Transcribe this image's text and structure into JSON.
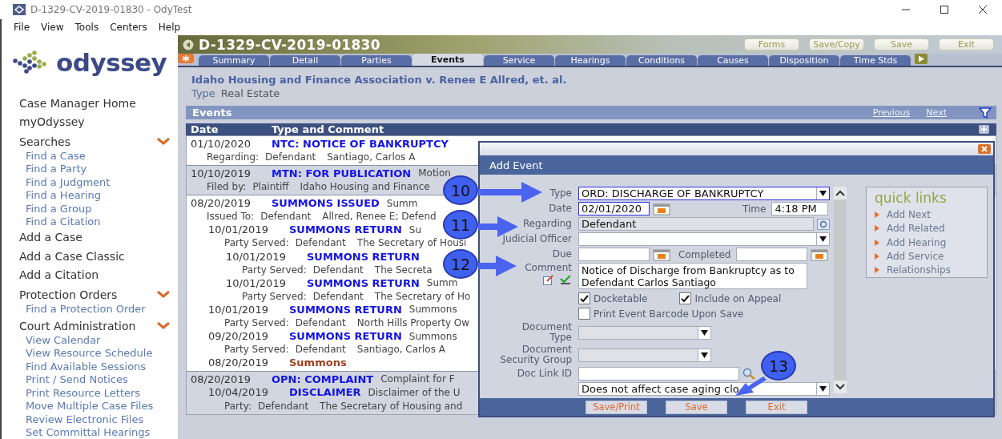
{
  "window": {
    "title": "D-1329-CV-2019-01830 - OdyTest"
  },
  "menu": [
    "File",
    "View",
    "Tools",
    "Centers",
    "Help"
  ],
  "sidebar": {
    "logo": "odyssey",
    "items": [
      {
        "kind": "link",
        "label": "Case Manager Home"
      },
      {
        "kind": "link",
        "label": "myOdyssey"
      },
      {
        "kind": "section",
        "label": "Searches",
        "expanded": true,
        "children": [
          "Find a Case",
          "Find a Party",
          "Find a Judgment",
          "Find a Hearing",
          "Find a Group",
          "Find a Citation"
        ]
      },
      {
        "kind": "link",
        "label": "Add a Case"
      },
      {
        "kind": "link",
        "label": "Add a Case Classic"
      },
      {
        "kind": "link",
        "label": "Add a Citation"
      },
      {
        "kind": "section",
        "label": "Protection Orders",
        "expanded": true,
        "children": [
          "Find a Protection Order"
        ]
      },
      {
        "kind": "section",
        "label": "Court Administration",
        "expanded": true,
        "children": [
          "View Calendar",
          "View Resource Schedule",
          "Find Available Sessions",
          "Print / Send Notices",
          "Print Resource Letters",
          "Move Multiple Case Files",
          "Review Electronic Files",
          "Set Committal Hearings"
        ]
      }
    ]
  },
  "case": {
    "number": "D-1329-CV-2019-01830",
    "buttons": [
      "Forms",
      "Save/Copy",
      "Save",
      "Exit"
    ],
    "tabs": [
      {
        "label": "Summary",
        "selected": false
      },
      {
        "label": "Detail",
        "selected": false
      },
      {
        "label": "Parties",
        "selected": false
      },
      {
        "label": "Events",
        "selected": true
      },
      {
        "label": "Service",
        "selected": false
      },
      {
        "label": "Hearings",
        "selected": false
      },
      {
        "label": "Conditions",
        "selected": false
      },
      {
        "label": "Causes",
        "selected": false
      },
      {
        "label": "Disposition",
        "selected": false
      },
      {
        "label": "Time Stds",
        "selected": false
      }
    ],
    "title": "Idaho Housing and Finance Association v. Renee E Allred, et. al.",
    "type_label": "Type",
    "type_value": "Real Estate"
  },
  "events": {
    "title": "Events",
    "nav": [
      "Previous",
      "Next"
    ],
    "columns": [
      "Date",
      "Type and Comment"
    ],
    "groups": [
      {
        "shaded": false,
        "events": [
          {
            "kind": "event",
            "date": "01/10/2020",
            "type": "NTC: NOTICE OF BANKRUPTCY",
            "detail": [
              "Regarding:",
              "Defendant",
              "Santiago, Carlos A"
            ]
          }
        ]
      },
      {
        "shaded": true,
        "events": [
          {
            "kind": "event",
            "date": "10/10/2019",
            "type": "MTN: FOR PUBLICATION",
            "comment": "Motion",
            "detail": [
              "Filed by:",
              "Plaintiff",
              "Idaho Housing and Finance"
            ]
          }
        ]
      },
      {
        "shaded": false,
        "events": [
          {
            "kind": "event",
            "date": "08/20/2019",
            "type": "SUMMONS ISSUED",
            "comment": "Summ",
            "detail": [
              "Issued To:",
              "Defendant",
              "Allred, Renee E; Defend"
            ],
            "children": [
              {
                "kind": "event",
                "date": "10/01/2019",
                "type": "SUMMONS RETURN",
                "comment": "Su",
                "detail": [
                  "Party Served:",
                  "Defendant",
                  "The Secretary of Housi"
                ],
                "children": [
                  {
                    "kind": "event",
                    "date": "10/01/2019",
                    "type": "SUMMONS RETURN",
                    "detail": [
                      "Party Served:",
                      "Defendant",
                      "The Secreta"
                    ]
                  },
                  {
                    "kind": "event",
                    "date": "10/01/2019",
                    "type": "SUMMONS RETURN",
                    "comment": "Summ",
                    "detail": [
                      "Party Served:",
                      "Defendant",
                      "The Secretary of Ho"
                    ]
                  }
                ]
              },
              {
                "kind": "event",
                "date": "10/01/2019",
                "type": "SUMMONS RETURN",
                "comment": "Summons",
                "detail": [
                  "Party Served:",
                  "Defendant",
                  "North Hills Property Ow"
                ]
              },
              {
                "kind": "event",
                "date": "09/20/2019",
                "type": "SUMMONS RETURN",
                "comment": "Summons",
                "detail": [
                  "Party Served:",
                  "Defendant",
                  "Santiago, Carlos A"
                ]
              },
              {
                "kind": "document",
                "date": "08/20/2019",
                "type": "Summons"
              }
            ]
          }
        ]
      },
      {
        "shaded": true,
        "events": [
          {
            "kind": "event",
            "date": "08/20/2019",
            "type": "OPN: COMPLAINT",
            "comment": "Complaint for F",
            "children": [
              {
                "kind": "event",
                "date": "10/04/2019",
                "type": "DISCLAIMER",
                "comment": "Disclaimer of the U",
                "detail": [
                  "Party:",
                  "Defendant",
                  "The Secretary of Housing and"
                ]
              }
            ]
          }
        ]
      }
    ]
  },
  "dialog": {
    "title": "Add Event",
    "type": {
      "label": "Type",
      "value": "ORD: DISCHARGE OF BANKRUPTCY"
    },
    "date": {
      "label": "Date",
      "value": "02/01/2020"
    },
    "time": {
      "label": "Time",
      "value": "4:18 PM"
    },
    "regarding": {
      "label": "Regarding",
      "value": "Defendant"
    },
    "judicial_officer": {
      "label": "Judicial Officer"
    },
    "due": {
      "label": "Due"
    },
    "completed": {
      "label": "Completed"
    },
    "comment": {
      "label": "Comment",
      "value": "Notice of Discharge from Bankruptcy as to Defendant Carlos Santiago"
    },
    "checkboxes": [
      {
        "label": "Docketable",
        "checked": true
      },
      {
        "label": "Include on Appeal",
        "checked": true
      },
      {
        "label": "Print Event Barcode Upon Save",
        "checked": false
      }
    ],
    "document_type": {
      "label": [
        "Document",
        "Type"
      ]
    },
    "security_group": {
      "label": [
        "Document",
        "Security Group"
      ]
    },
    "doc_link": {
      "label": "Doc Link ID"
    },
    "aging": {
      "value": "Does not affect case aging clo"
    },
    "buttons": [
      "Save/Print",
      "Save",
      "Exit"
    ],
    "quick_links": {
      "title": "quick links",
      "items": [
        "Add Next",
        "Add Related",
        "Add Hearing",
        "Add Service",
        "Relationships"
      ]
    }
  },
  "callouts": [
    "10",
    "11",
    "12",
    "13"
  ]
}
